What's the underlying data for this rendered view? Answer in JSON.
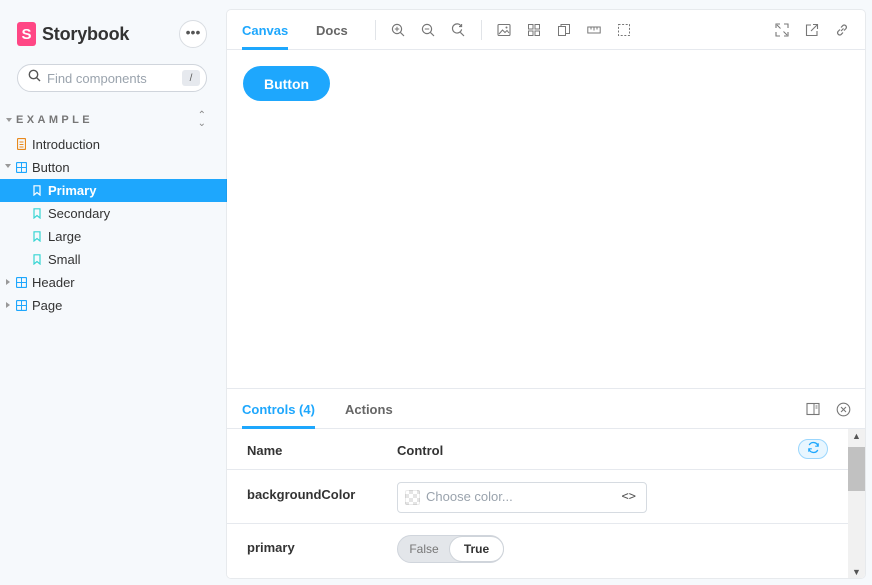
{
  "brand": {
    "name": "Storybook",
    "logo_letter": "S",
    "color": "#ff4785"
  },
  "sidebar": {
    "menu_label": "•••",
    "search_placeholder": "Find components",
    "search_shortcut": "/",
    "group": "EXAMPLE",
    "items": [
      {
        "label": "Introduction",
        "kind": "document"
      },
      {
        "label": "Button",
        "kind": "component",
        "expanded": true
      },
      {
        "label": "Primary",
        "kind": "story",
        "selected": true
      },
      {
        "label": "Secondary",
        "kind": "story"
      },
      {
        "label": "Large",
        "kind": "story"
      },
      {
        "label": "Small",
        "kind": "story"
      },
      {
        "label": "Header",
        "kind": "component",
        "expanded": false
      },
      {
        "label": "Page",
        "kind": "component",
        "expanded": false
      }
    ]
  },
  "toolbar": {
    "tabs": [
      "Canvas",
      "Docs"
    ],
    "active_tab": "Canvas",
    "tools": [
      "zoom-in-icon",
      "zoom-out-icon",
      "zoom-reset-icon",
      "background-icon",
      "grid-icon",
      "viewport-icon",
      "measure-icon",
      "outline-icon"
    ],
    "right_tools": [
      "fullscreen-icon",
      "open-new-tab-icon",
      "copy-link-icon"
    ]
  },
  "preview": {
    "button_label": "Button",
    "accent": "#1ea7fd"
  },
  "addons": {
    "tabs": [
      "Controls (4)",
      "Actions"
    ],
    "active_tab": "Controls (4)",
    "columns": [
      "Name",
      "Control"
    ],
    "rows": [
      {
        "name": "backgroundColor",
        "placeholder": "Choose color...",
        "code": "<>"
      },
      {
        "name": "primary",
        "false_label": "False",
        "true_label": "True",
        "value": true
      }
    ]
  }
}
